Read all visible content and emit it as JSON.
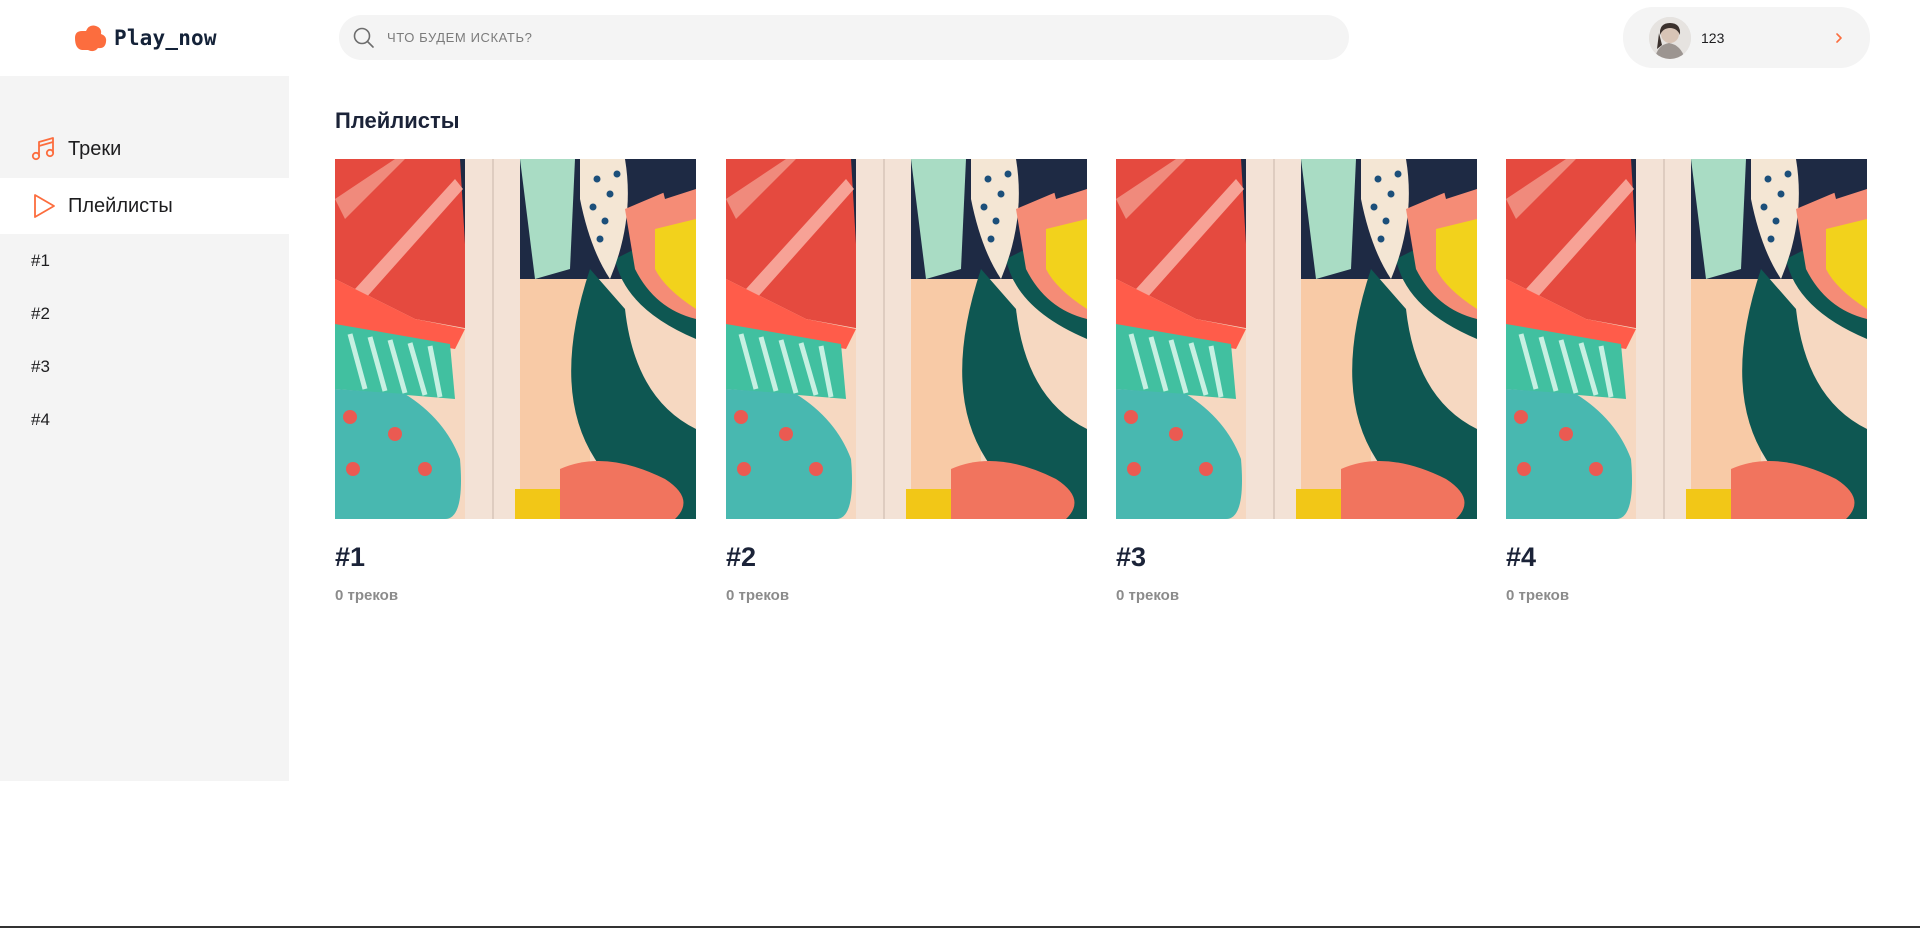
{
  "app": {
    "logo_text": "Play_now"
  },
  "search": {
    "placeholder": "что будем искать?"
  },
  "user": {
    "name": "123"
  },
  "sidebar": {
    "nav": [
      {
        "label": "Треки",
        "icon": "music-note-icon"
      },
      {
        "label": "Плейлисты",
        "icon": "play-icon"
      }
    ],
    "playlists": [
      "#1",
      "#2",
      "#3",
      "#4"
    ]
  },
  "main": {
    "title": "Плейлисты",
    "cards": [
      {
        "title": "#1",
        "subtitle": "0 треков"
      },
      {
        "title": "#2",
        "subtitle": "0 треков"
      },
      {
        "title": "#3",
        "subtitle": "0 треков"
      },
      {
        "title": "#4",
        "subtitle": "0 треков"
      }
    ]
  },
  "colors": {
    "accent": "#fc6d3e",
    "dark": "#1b2338",
    "panel": "#f4f4f4",
    "muted": "#8b8b8b"
  }
}
